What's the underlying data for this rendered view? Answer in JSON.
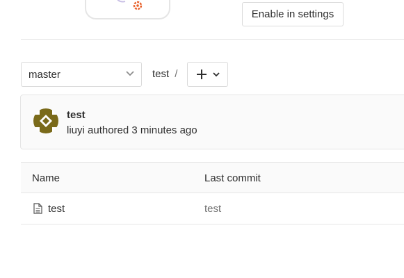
{
  "settings_prompt": {
    "enable_button_label": "Enable in settings"
  },
  "repo_nav": {
    "branch": "master",
    "breadcrumb": {
      "project": "test",
      "separator": "/"
    },
    "add_icon": "plus-icon",
    "dropdown_icon": "chevron-down-icon"
  },
  "last_commit": {
    "title": "test",
    "meta": "liuyi authored 3 minutes ago",
    "avatar_color": "#7a6a1a"
  },
  "file_table": {
    "headers": {
      "name": "Name",
      "last_commit": "Last commit"
    },
    "rows": [
      {
        "name": "test",
        "icon": "file-icon",
        "last_commit": "test"
      }
    ]
  },
  "colors": {
    "border": "#e5e5e5",
    "panel_bg": "#fafafa",
    "gear_orange": "#e8612c",
    "gear_purple": "#a99ad6"
  }
}
